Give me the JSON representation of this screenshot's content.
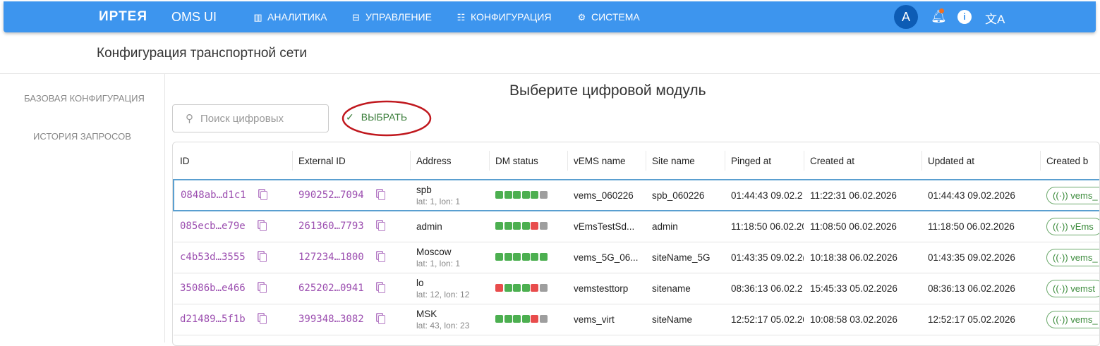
{
  "header": {
    "brand": "ИРТЕЯ",
    "app": "OMS UI",
    "nav": [
      {
        "label": "АНАЛИТИКА",
        "icon": "analytics-icon"
      },
      {
        "label": "УПРАВЛЕНИЕ",
        "icon": "management-icon"
      },
      {
        "label": "КОНФИГУРАЦИЯ",
        "icon": "tune-icon"
      },
      {
        "label": "СИСТЕМА",
        "icon": "gear-icon"
      }
    ],
    "avatar": "A"
  },
  "page_title": "Конфигурация транспортной сети",
  "sidebar": [
    "БАЗОВАЯ КОНФИГУРАЦИЯ",
    "ИСТОРИЯ ЗАПРОСОВ"
  ],
  "main": {
    "heading": "Выберите цифровой модуль",
    "search_placeholder": "Поиск цифровых",
    "select_label": "ВЫБРАТЬ"
  },
  "colors": {
    "ok": "#4caf50",
    "error": "#e84c4c",
    "unknown": "#9e9e9e",
    "accent": "#3d95ee"
  },
  "table": {
    "columns": [
      "ID",
      "External ID",
      "Address",
      "DM status",
      "vEMS name",
      "Site name",
      "Pinged at",
      "Created at",
      "Updated at",
      "Created b"
    ],
    "rows": [
      {
        "id": "0848ab…d1c1",
        "ext": "990252…7094",
        "addr": "spb",
        "coords": "lat: 1, lon: 1",
        "status": [
          "ok",
          "ok",
          "ok",
          "ok",
          "ok",
          "unknown"
        ],
        "vems": "vems_060226",
        "site": "spb_060226",
        "pinged": "01:44:43 09.02.2",
        "created": "11:22:31 06.02.2026",
        "updated": "01:44:43 09.02.2026",
        "by": "vems_"
      },
      {
        "id": "085ecb…e79e",
        "ext": "261360…7793",
        "addr": "admin",
        "coords": "",
        "status": [
          "ok",
          "ok",
          "ok",
          "ok",
          "error",
          "unknown"
        ],
        "vems": "vEmsTestSd...",
        "site": "admin",
        "pinged": "11:18:50 06.02.20",
        "created": "11:08:50 06.02.2026",
        "updated": "11:18:50 06.02.2026",
        "by": "vEms"
      },
      {
        "id": "c4b53d…3555",
        "ext": "127234…1800",
        "addr": "Moscow",
        "coords": "lat: 1, lon: 1",
        "status": [
          "ok",
          "ok",
          "ok",
          "ok",
          "ok",
          "ok"
        ],
        "vems": "vems_5G_06...",
        "site": "siteName_5G",
        "pinged": "01:43:35 09.02.2(",
        "created": "10:18:38 06.02.2026",
        "updated": "01:43:35 09.02.2026",
        "by": "vems_"
      },
      {
        "id": "35086b…e466",
        "ext": "625202…0941",
        "addr": "lo",
        "coords": "lat: 12, lon: 12",
        "status": [
          "error",
          "ok",
          "ok",
          "ok",
          "error",
          "unknown"
        ],
        "vems": "vemstesttorp",
        "site": "sitename",
        "pinged": "08:36:13 06.02.2",
        "created": "15:45:33 05.02.2026",
        "updated": "08:36:13 06.02.2026",
        "by": "vemst"
      },
      {
        "id": "d21489…5f1b",
        "ext": "399348…3082",
        "addr": "MSK",
        "coords": "lat: 43, lon: 23",
        "status": [
          "ok",
          "ok",
          "ok",
          "ok",
          "error",
          "unknown"
        ],
        "vems": "vems_virt",
        "site": "siteName",
        "pinged": "12:52:17 05.02.20",
        "created": "10:08:58 03.02.2026",
        "updated": "12:52:17 05.02.2026",
        "by": "vems_"
      }
    ]
  }
}
